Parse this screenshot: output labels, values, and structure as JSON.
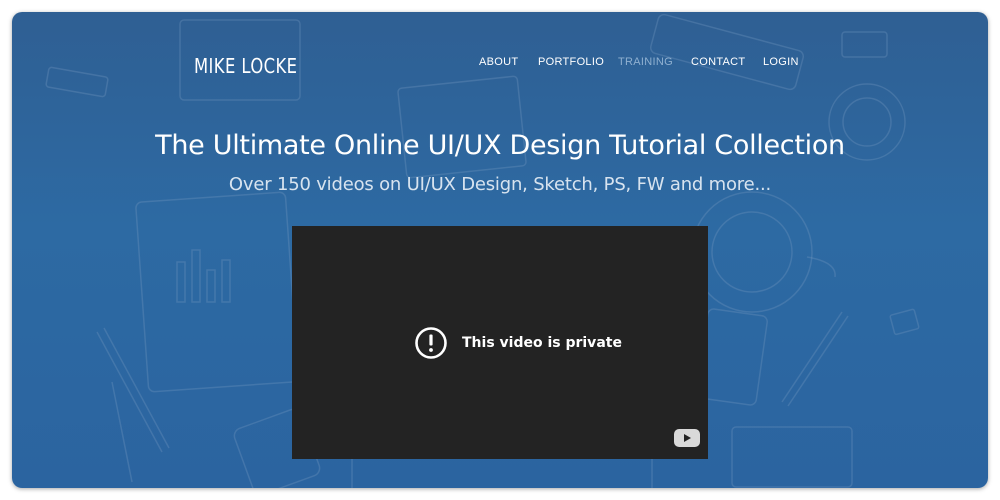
{
  "site": {
    "logo": "MIKE LOCKE"
  },
  "nav": {
    "items": [
      {
        "label": "ABOUT"
      },
      {
        "label": "PORTFOLIO"
      },
      {
        "label": "TRAINING"
      },
      {
        "label": "CONTACT"
      },
      {
        "label": "LOGIN"
      }
    ],
    "active_item": "TRAINING"
  },
  "hero": {
    "headline": "The Ultimate Online UI/UX Design Tutorial Collection",
    "subheadline": "Over 150 videos on UI/UX Design, Sketch, PS, FW and more..."
  },
  "video": {
    "message": "This video is private",
    "icons": [
      "alert-circle-icon",
      "youtube-icon"
    ]
  },
  "colors": {
    "background_blue": "#2d6aa3",
    "video_background": "#232323",
    "muted_nav": "#8fb0d0",
    "text": "#ffffff"
  }
}
